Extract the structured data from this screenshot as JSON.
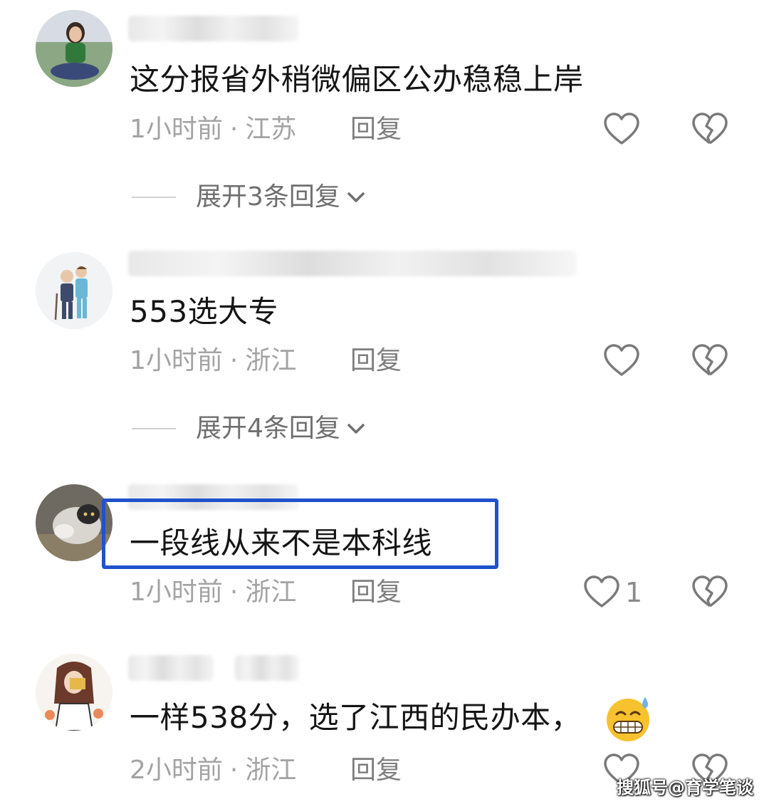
{
  "comments": [
    {
      "content": "这分报省外稍微偏区公办稳稳上岸",
      "time": "1小时前",
      "dot": "·",
      "location": "江苏",
      "reply": "回复",
      "expand": "展开3条回复"
    },
    {
      "content": "553选大专",
      "time": "1小时前",
      "dot": "·",
      "location": "浙江",
      "reply": "回复",
      "expand": "展开4条回复"
    },
    {
      "content": "一段线从来不是本科线",
      "time": "1小时前",
      "dot": "·",
      "location": "浙江",
      "reply": "回复",
      "likes": "1"
    },
    {
      "content": "一样538分，选了江西的民办本，",
      "time": "2小时前",
      "dot": "·",
      "location": "浙江",
      "reply": "回复",
      "emoji": "grimacing-sweat-emoji"
    }
  ],
  "icons": {
    "like": "heart-outline-icon",
    "dislike": "broken-heart-icon",
    "expand": "chevron-down-icon"
  },
  "colors": {
    "highlight_border": "#1f52cc",
    "text_primary": "#151515",
    "text_meta": "#a3a3a3"
  },
  "watermark": "搜狐号@育学笔谈"
}
